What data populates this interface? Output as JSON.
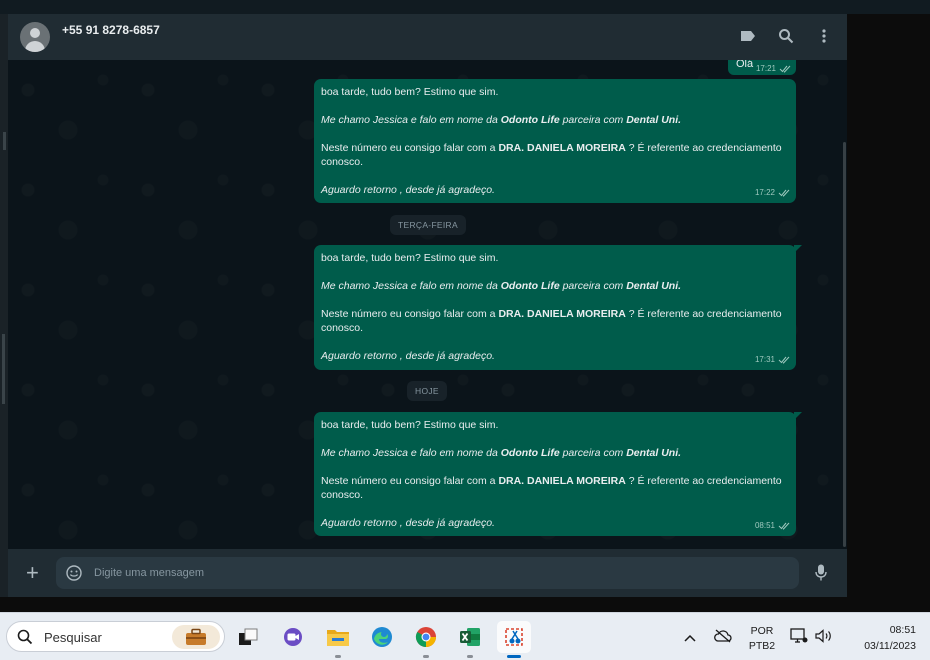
{
  "header": {
    "contact_name": "+55 91 8278-6857",
    "icons": [
      "label-icon",
      "search-icon",
      "more-vertical-icon"
    ]
  },
  "messages": [
    {
      "text": "Olá",
      "time": "17:21",
      "status": "read"
    },
    {
      "lines": [
        {
          "parts": [
            {
              "t": "boa tarde,  tudo bem? Estimo que sim."
            }
          ]
        },
        {
          "parts": [
            {
              "t": "Me chamo Jessica e falo em nome da ",
              "i": true
            },
            {
              "t": "Odonto Life",
              "i": true,
              "b": true
            },
            {
              "t": " parceira com ",
              "i": true
            },
            {
              "t": "Dental Uni.",
              "i": true,
              "b": true
            }
          ]
        },
        {
          "parts": [
            {
              "t": "Neste número eu consigo falar com a "
            },
            {
              "t": "DRA. DANIELA MOREIRA",
              "b": true
            },
            {
              "t": " ? É referente ao credenciamento"
            }
          ]
        },
        {
          "parts": [
            {
              "t": "Aguardo retorno , desde já agradeço.",
              "i": true
            }
          ]
        }
      ],
      "continuation": "conosco.",
      "time": "17:22",
      "status": "read"
    },
    {
      "time": "17:31",
      "status": "read"
    },
    {
      "time": "08:51",
      "status": "read"
    }
  ],
  "day_separators": [
    "TERÇA-FEIRA",
    "HOJE"
  ],
  "composer": {
    "placeholder": "Digite uma mensagem"
  },
  "taskbar": {
    "search_label": "Pesquisar",
    "apps": [
      "briefcase-icon",
      "task-view-icon",
      "video-call-icon",
      "file-explorer-icon",
      "edge-browser-icon",
      "chrome-browser-icon",
      "excel-icon",
      "snipping-tool-icon"
    ],
    "language_top": "POR",
    "language_bottom": "PTB2",
    "time": "08:51",
    "date": "03/11/2023"
  },
  "colors": {
    "outgoing_bubble": "#005c4b",
    "chat_background": "#0b141a",
    "header_background": "#202c33",
    "taskbar_background": "#e8edf3",
    "accent": "#0067c0"
  }
}
